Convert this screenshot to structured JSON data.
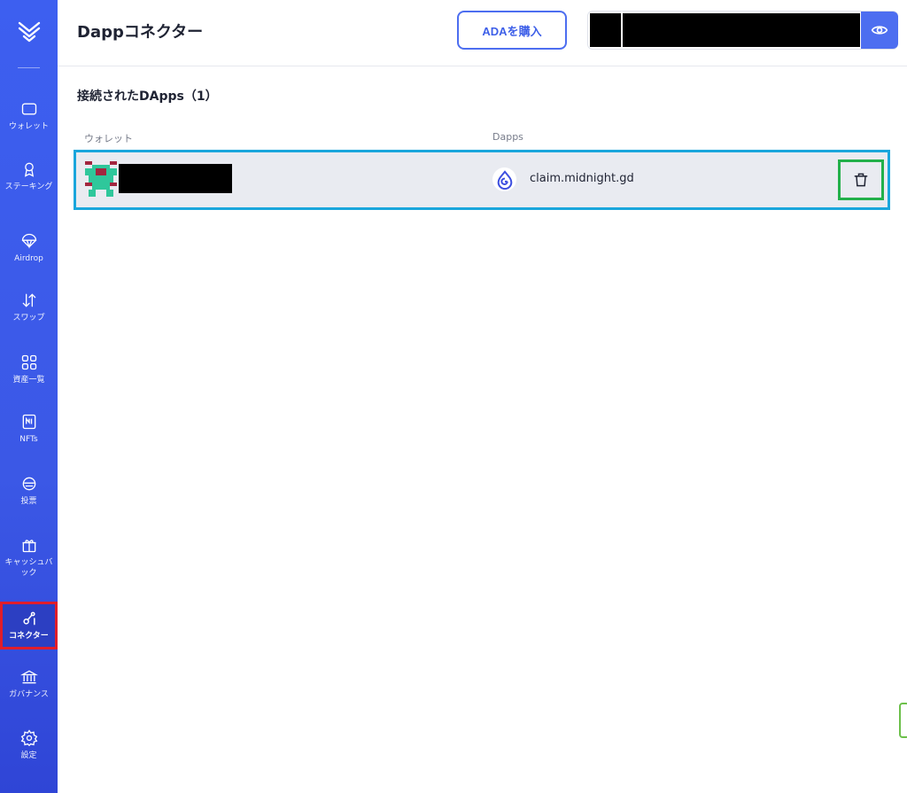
{
  "sidebar": {
    "items": [
      {
        "id": "wallet",
        "label": "ウォレット",
        "icon": "wallet-icon"
      },
      {
        "id": "staking",
        "label": "ステーキング",
        "icon": "award-icon"
      },
      {
        "id": "airdrop",
        "label": "Airdrop",
        "icon": "parachute-icon"
      },
      {
        "id": "swap",
        "label": "スワップ",
        "icon": "swap-arrows-icon"
      },
      {
        "id": "assets",
        "label": "資産一覧",
        "icon": "grid-icon"
      },
      {
        "id": "nfts",
        "label": "NFTs",
        "icon": "nft-icon"
      },
      {
        "id": "vote",
        "label": "投票",
        "icon": "vote-icon"
      },
      {
        "id": "cashback",
        "label": "キャッシュバック",
        "icon": "gift-icon"
      },
      {
        "id": "connector",
        "label": "コネクター",
        "icon": "connector-icon",
        "active": true
      },
      {
        "id": "governance",
        "label": "ガバナンス",
        "icon": "bank-icon"
      },
      {
        "id": "settings",
        "label": "設定",
        "icon": "gear-icon"
      }
    ]
  },
  "header": {
    "title": "Dappコネクター",
    "buy_label": "ADAを購入"
  },
  "main": {
    "section_title": "接続されたDApps（1）",
    "columns": {
      "wallet": "ウォレット",
      "dapps": "Dapps"
    },
    "rows": [
      {
        "dapp_url": "claim.midnight.gd"
      }
    ]
  },
  "colors": {
    "sidebar": "#3d5ff0",
    "accent": "#4d6ef0",
    "row_highlight": "#1aa6dc",
    "delete_highlight": "#22b04a",
    "active_highlight": "#e11d2a"
  }
}
